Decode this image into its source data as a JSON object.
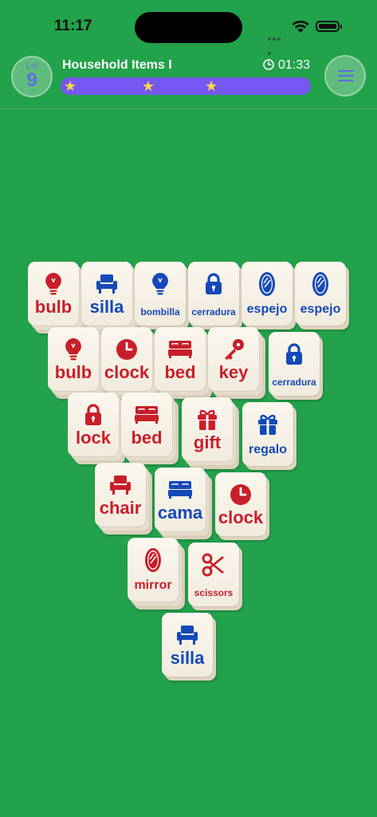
{
  "status": {
    "time": "11:17"
  },
  "header": {
    "level_label": "Lvl",
    "level": "9",
    "title": "Household Items I",
    "timer": "01:33",
    "progress": 1.0
  },
  "colors": {
    "red": "#c81f2a",
    "blue": "#1549b8",
    "background": "#22a24a",
    "progress": "#7658f2"
  },
  "tiles": [
    {
      "word": "bulb",
      "icon": "bulb-icon",
      "color": "red"
    },
    {
      "word": "silla",
      "icon": "chair-icon",
      "color": "blue"
    },
    {
      "word": "bombilla",
      "icon": "bulb-icon",
      "color": "blue"
    },
    {
      "word": "cerradura",
      "icon": "lock-icon",
      "color": "blue"
    },
    {
      "word": "espejo",
      "icon": "mirror-icon",
      "color": "blue"
    },
    {
      "word": "espejo",
      "icon": "mirror-icon",
      "color": "blue"
    },
    {
      "word": "bulb",
      "icon": "bulb-icon",
      "color": "red"
    },
    {
      "word": "clock",
      "icon": "clock-icon",
      "color": "red"
    },
    {
      "word": "bed",
      "icon": "bed-icon",
      "color": "red"
    },
    {
      "word": "key",
      "icon": "key-icon",
      "color": "red"
    },
    {
      "word": "cerradura",
      "icon": "lock-icon",
      "color": "blue"
    },
    {
      "word": "lock",
      "icon": "lock-icon",
      "color": "red"
    },
    {
      "word": "bed",
      "icon": "bed-icon",
      "color": "red"
    },
    {
      "word": "gift",
      "icon": "gift-icon",
      "color": "red"
    },
    {
      "word": "regalo",
      "icon": "gift-icon",
      "color": "blue"
    },
    {
      "word": "chair",
      "icon": "chair-icon",
      "color": "red"
    },
    {
      "word": "cama",
      "icon": "bed-icon",
      "color": "blue"
    },
    {
      "word": "clock",
      "icon": "clock-icon",
      "color": "red"
    },
    {
      "word": "mirror",
      "icon": "mirror-icon",
      "color": "red"
    },
    {
      "word": "scissors",
      "icon": "scissors-icon",
      "color": "red"
    },
    {
      "word": "silla",
      "icon": "chair-icon",
      "color": "blue"
    }
  ]
}
